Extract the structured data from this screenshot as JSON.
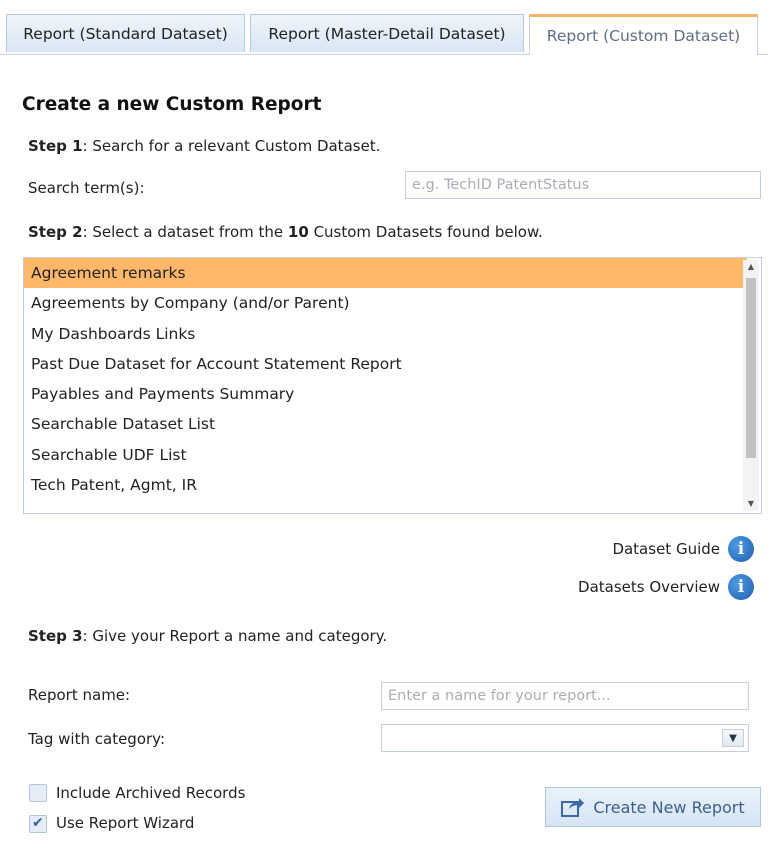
{
  "tabs": [
    {
      "label": "Report (Standard Dataset)"
    },
    {
      "label": "Report (Master-Detail Dataset)"
    },
    {
      "label": "Report (Custom Dataset)"
    }
  ],
  "heading": "Create a new Custom Report",
  "step1": {
    "bold": "Step 1",
    "text": ": Search for a relevant Custom Dataset."
  },
  "search": {
    "label": "Search term(s):",
    "placeholder": "e.g. TechID PatentStatus",
    "value": ""
  },
  "step2": {
    "bold": "Step 2",
    "text_a": ": Select a dataset from the ",
    "count": "10",
    "text_b": " Custom Datasets found below."
  },
  "datasets": [
    "Agreement remarks",
    "Agreements by Company (and/or Parent)",
    "My Dashboards Links",
    "Past Due Dataset for Account Statement Report",
    "Payables and Payments Summary",
    "Searchable Dataset List",
    "Searchable UDF List",
    "Tech Patent, Agmt, IR"
  ],
  "selected_dataset": "Agreement remarks",
  "guides": {
    "dataset_guide": "Dataset Guide",
    "datasets_overview": "Datasets Overview",
    "info_glyph": "i"
  },
  "step3": {
    "bold": "Step 3",
    "text": ": Give your Report a name and category."
  },
  "report_name": {
    "label": "Report name:",
    "placeholder": "Enter a name for your report...",
    "value": ""
  },
  "category": {
    "label": "Tag with category:",
    "value": ""
  },
  "options": {
    "archived": {
      "label": "Include Archived Records",
      "checked": false
    },
    "wizard": {
      "label": "Use Report Wizard",
      "checked": true
    }
  },
  "create_button": {
    "label": "Create New Report"
  },
  "colors": {
    "selected_row": "#ffb86a",
    "active_tab_accent": "#f6b565",
    "info_icon": "#2f6fbf"
  }
}
